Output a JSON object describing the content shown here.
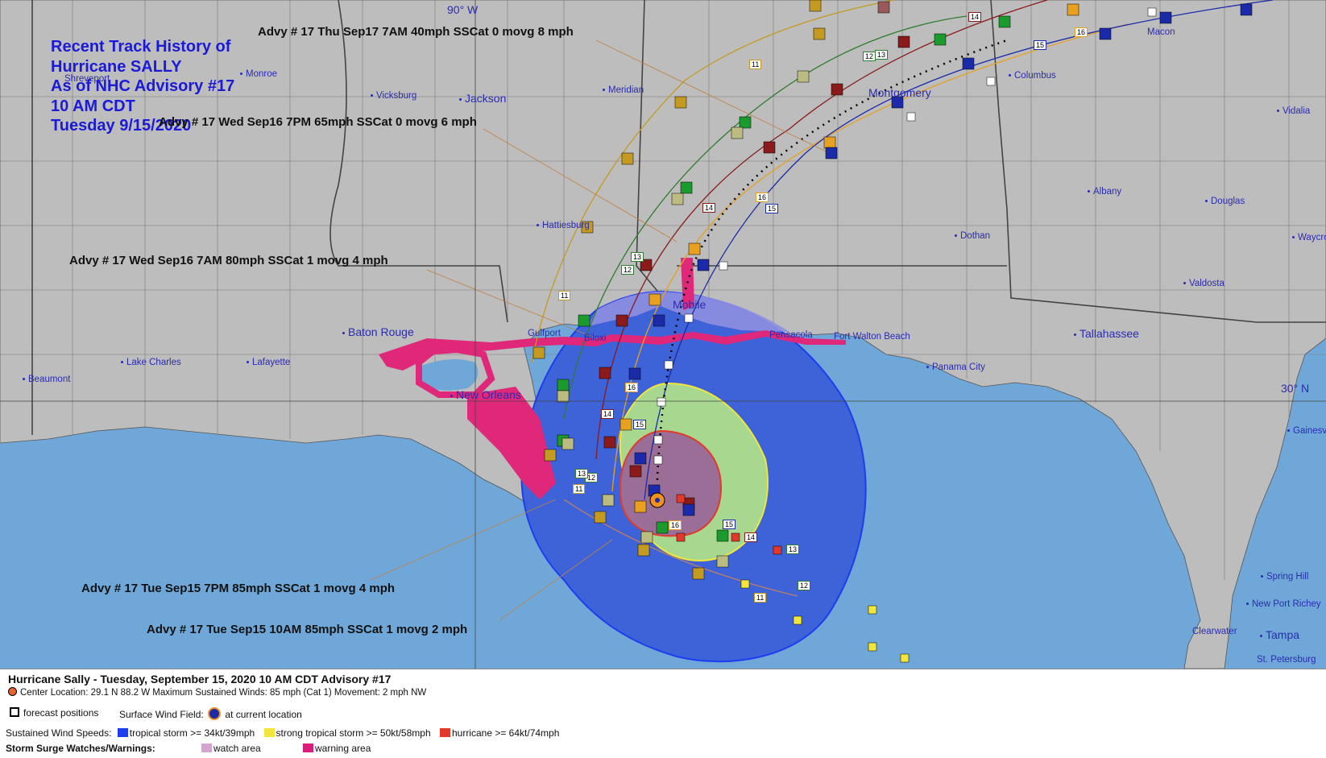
{
  "map": {
    "title_lines": [
      "Recent Track History of",
      "Hurricane SALLY",
      "As of NHC Advisory #17",
      "10 AM CDT",
      "Tuesday 9/15/2020"
    ],
    "advisory_labels": [
      "Advy # 17 Thu Sep17 7AM  40mph SSCat 0 movg 8 mph",
      "Advy # 17 Wed Sep16 7PM  65mph SSCat 0 movg 6 mph",
      "Advy # 17 Wed Sep16 7AM  80mph SSCat 1 movg 4 mph",
      "Advy # 17 Tue Sep15 7PM  85mph SSCat 1 movg 4 mph",
      "Advy # 17 Tue Sep15 10AM  85mph SSCat 1 movg 2 mph"
    ],
    "lat_lon_labels": [
      "90° W",
      "30° N"
    ],
    "cities": [
      "Shreveport",
      "Monroe",
      "Vicksburg",
      "Jackson",
      "Meridian",
      "Montgomery",
      "Columbus",
      "Macon",
      "Vidalia",
      "Hattiesburg",
      "Albany",
      "Douglas",
      "Dothan",
      "Waycross",
      "Valdosta",
      "Mobile",
      "Baton Rouge",
      "Gulfport",
      "Biloxi",
      "Pensacola",
      "Fort Walton Beach",
      "Tallahassee",
      "Lake Charles",
      "Lafayette",
      "Panama City",
      "Beaumont",
      "New Orleans",
      "Gainesville",
      "Spring Hill",
      "New Port Richey",
      "Clearwater",
      "Tampa",
      "St. Petersburg"
    ],
    "forecast_day_labels": [
      "11",
      "12",
      "13",
      "14",
      "15",
      "16"
    ],
    "colors": {
      "land": "#bdbdbd",
      "water": "#6fa8d8",
      "tropical_storm": "#3b5ed8",
      "strong_tropical_storm": "#a8d890",
      "hurricane": "#9a6e96",
      "warning": "#e0287a",
      "title": "#1a1ad8"
    }
  },
  "legend": {
    "header": "Hurricane Sally  -  Tuesday, September 15, 2020  10 AM CDT   Advisory #17",
    "center_location": "Center Location: 29.1 N  88.2 W   Maximum Sustained Winds: 85 mph (Cat 1) Movement: 2 mph NW",
    "forecast_positions": "forecast positions",
    "surface_wind_field": "Surface Wind Field:",
    "at_current_location": "at current location",
    "sustained_wind_speeds": "Sustained Wind Speeds:",
    "wind_classes": [
      {
        "label": "tropical storm >= 34kt/39mph",
        "color": "#1e3cf0"
      },
      {
        "label": "strong tropical storm >= 50kt/58mph",
        "color": "#f2e63a"
      },
      {
        "label": "hurricane >= 64kt/74mph",
        "color": "#e2392a"
      }
    ],
    "storm_surge": "Storm Surge Watches/Warnings:",
    "surge_classes": [
      {
        "label": "watch area",
        "color": "#d4a4d0"
      },
      {
        "label": "warning area",
        "color": "#d81e78"
      }
    ]
  }
}
